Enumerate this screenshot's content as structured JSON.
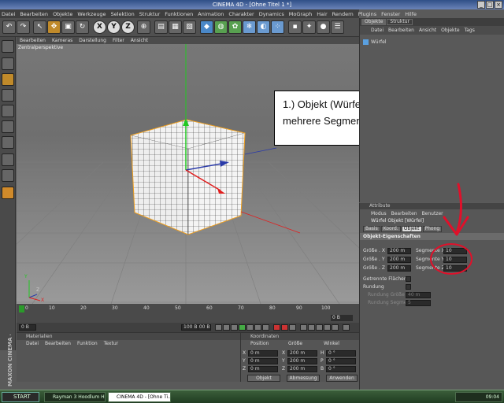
{
  "window": {
    "title": "CINEMA 4D - [Ohne Titel 1 *]"
  },
  "menubar": [
    "Datei",
    "Bearbeiten",
    "Objekte",
    "Werkzeuge",
    "Selektion",
    "Struktur",
    "Funktionen",
    "Animation",
    "Charakter",
    "Dynamics",
    "MoGraph",
    "Hair",
    "Rendern",
    "Plugins",
    "Fenster",
    "Hilfe"
  ],
  "viewport": {
    "menu": [
      "Bearbeiten",
      "Kameras",
      "Darstellung",
      "Filter",
      "Ansicht"
    ],
    "label": "Zentralperspektive",
    "axis_x": "X",
    "axis_y": "Y",
    "axis_z": "Z"
  },
  "annotation": {
    "line1": "1.) Objekt (Würfel) erstellen und in",
    "line2": "mehrere Segmente teilen."
  },
  "timeline": {
    "ticks": [
      "0",
      "10",
      "20",
      "30",
      "40",
      "50",
      "60",
      "70",
      "80",
      "90",
      "100"
    ],
    "current_frame": "0 B",
    "start_field": "0 B",
    "end_field": "100 B",
    "mid_field": "100 B"
  },
  "material_manager": {
    "title": "Materialien",
    "menu": [
      "Datei",
      "Bearbeiten",
      "Funktion",
      "Textur"
    ]
  },
  "coordinates": {
    "title": "Koordinaten",
    "headers": [
      "Position",
      "Größe",
      "Winkel"
    ],
    "rows": [
      {
        "axis": "X",
        "pos": "0 m",
        "size_axis": "X",
        "size": "200 m",
        "angle_axis": "H",
        "angle": "0 °"
      },
      {
        "axis": "Y",
        "pos": "0 m",
        "size_axis": "Y",
        "size": "200 m",
        "angle_axis": "P",
        "angle": "0 °"
      },
      {
        "axis": "Z",
        "pos": "0 m",
        "size_axis": "Z",
        "size": "200 m",
        "angle_axis": "B",
        "angle": "0 °"
      }
    ],
    "mode_select": "Objekt",
    "size_select": "Abmessung",
    "apply_button": "Anwenden"
  },
  "object_manager": {
    "tabs": [
      "Objekte",
      "Struktur"
    ],
    "menu": [
      "Datei",
      "Bearbeiten",
      "Ansicht",
      "Objekte",
      "Tags"
    ],
    "items": [
      {
        "name": "Würfel"
      }
    ]
  },
  "attributes": {
    "title": "Attribute",
    "menu": [
      "Modus",
      "Bearbeiten",
      "Benutzer"
    ],
    "object_title": "Würfel Objekt [Würfel]",
    "tabs": [
      "Basis",
      "Koord.",
      "Objekt",
      "Phong"
    ],
    "active_tab": "Objekt",
    "section": "Objekt-Eigenschaften",
    "size_rows": [
      {
        "label": "Größe . X",
        "value": "200 m",
        "seg_label": "Segmente X",
        "seg_value": "10"
      },
      {
        "label": "Größe . Y",
        "value": "200 m",
        "seg_label": "Segmente Y",
        "seg_value": "10"
      },
      {
        "label": "Größe . Z",
        "value": "200 m",
        "seg_label": "Segmente Z",
        "seg_value": "10"
      }
    ],
    "separate_faces": "Getrennte Flächen",
    "fillet": "Rundung",
    "fillet_size_label": "Rundung Größe",
    "fillet_size_value": "40 m",
    "fillet_segments_label": "Rundung Segmente",
    "fillet_segments_value": "5"
  },
  "taskbar": {
    "start": "START",
    "tasks": [
      "Rayman 3 Hoodlum Ha...",
      "CINEMA 4D - [Ohne Ti..."
    ],
    "clock": "09:04"
  },
  "branding": "MAXON CINEMA 4D",
  "colors": {
    "highlight_red": "#e0102a",
    "selection_orange": "#f0a020",
    "axis_green": "#22c822",
    "axis_red": "#e02020",
    "axis_blue": "#2a3aa8"
  }
}
